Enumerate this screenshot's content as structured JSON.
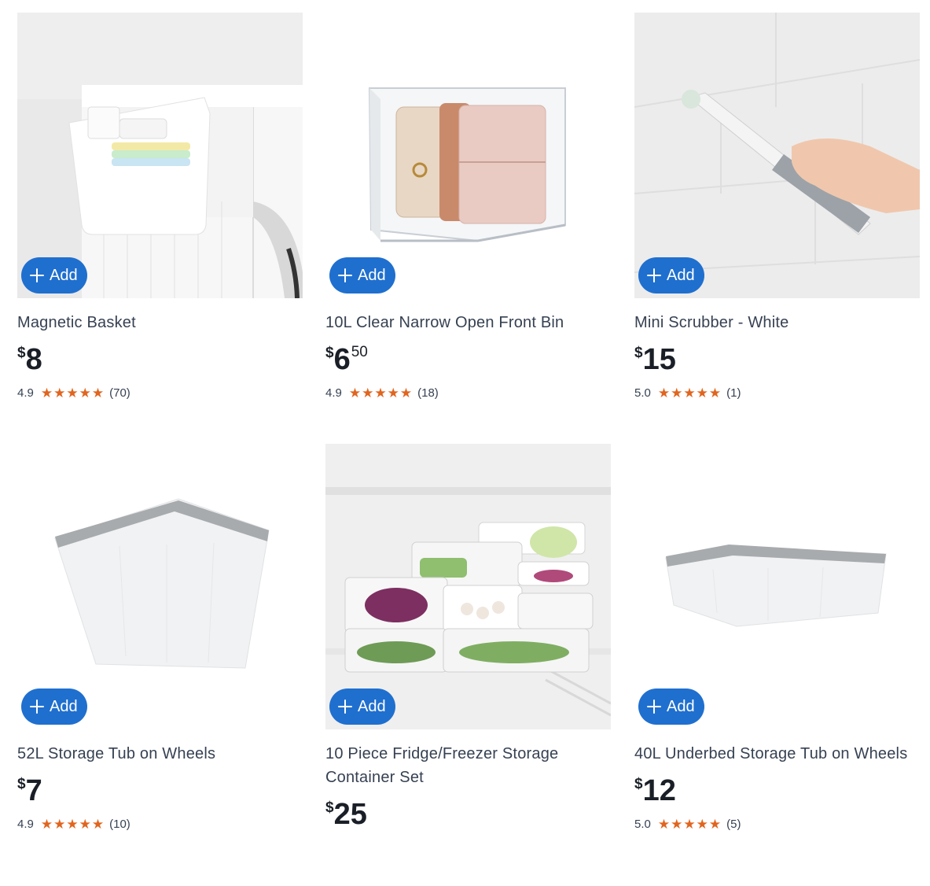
{
  "products": [
    {
      "name": "Magnetic Basket",
      "currency": "$",
      "dollars": "8",
      "cents": "",
      "rating": "4.9",
      "reviews": "(70)",
      "add_label": "Add",
      "stars": 5
    },
    {
      "name": "10L Clear Narrow Open Front Bin",
      "currency": "$",
      "dollars": "6",
      "cents": "50",
      "rating": "4.9",
      "reviews": "(18)",
      "add_label": "Add",
      "stars": 5
    },
    {
      "name": "Mini Scrubber - White",
      "currency": "$",
      "dollars": "15",
      "cents": "",
      "rating": "5.0",
      "reviews": "(1)",
      "add_label": "Add",
      "stars": 5
    },
    {
      "name": "52L Storage Tub on Wheels",
      "currency": "$",
      "dollars": "7",
      "cents": "",
      "rating": "4.9",
      "reviews": "(10)",
      "add_label": "Add",
      "stars": 5
    },
    {
      "name": "10 Piece Fridge/Freezer Storage Container Set",
      "currency": "$",
      "dollars": "25",
      "cents": "",
      "rating": "",
      "reviews": "",
      "add_label": "Add",
      "stars": 0
    },
    {
      "name": "40L Underbed Storage Tub on Wheels",
      "currency": "$",
      "dollars": "12",
      "cents": "",
      "rating": "5.0",
      "reviews": "(5)",
      "add_label": "Add",
      "stars": 5
    }
  ],
  "icons": {
    "add": "plus-icon",
    "star": "star-icon"
  },
  "colors": {
    "add_button": "#1f6fcf",
    "star": "#e0651f",
    "price": "#1a1f27",
    "title": "#364152"
  }
}
